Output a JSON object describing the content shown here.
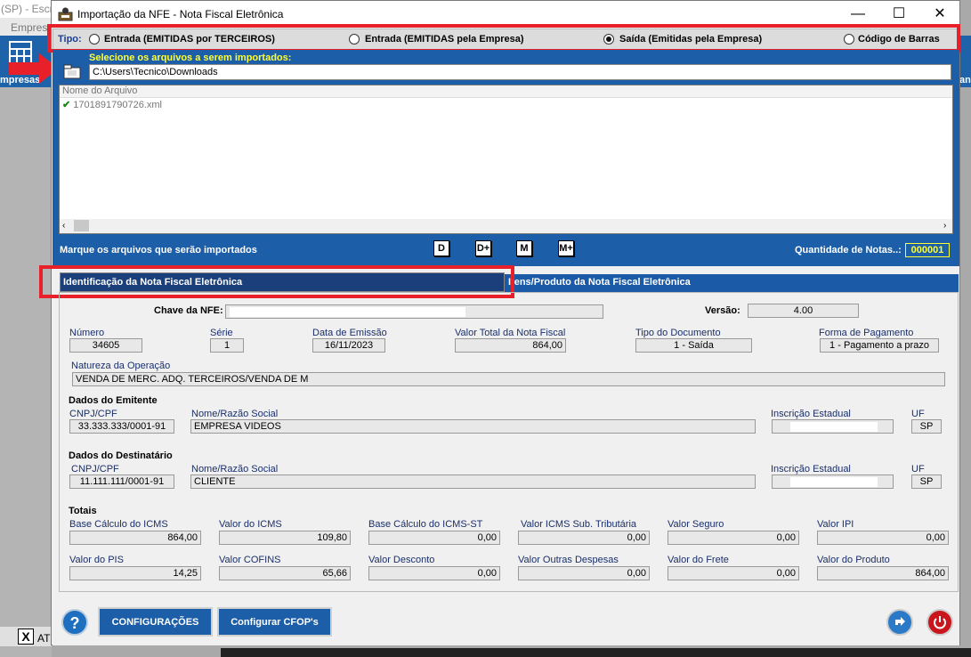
{
  "background": {
    "app_title": "(SP) - Escr",
    "menu_label": "Empres",
    "ribbon_label": "mpresas",
    "ribbon_label_right": "an",
    "close_x": "X",
    "at_label": "AT"
  },
  "window": {
    "title": "Importação da NFE - Nota Fiscal Eletrônica",
    "minimize": "—",
    "maximize": "☐",
    "close": "✕"
  },
  "tipo": {
    "label": "Tipo:",
    "options": [
      {
        "label": "Entrada (EMITIDAS por TERCEIROS)",
        "selected": false
      },
      {
        "label": "Entrada (EMITIDAS pela Empresa)",
        "selected": false
      },
      {
        "label": "Saída (Emitidas pela Empresa)",
        "selected": true
      },
      {
        "label": "Código de Barras",
        "selected": false
      }
    ]
  },
  "import": {
    "select_label": "Selecione os arquivos a serem importados:",
    "path": "C:\\Users\\Tecnico\\Downloads",
    "list_header": "Nome do Arquivo",
    "files": [
      "1701891790726.xml"
    ],
    "mark_label": "Marque os arquivos que serão importados",
    "buttons": [
      "D",
      "D+",
      "M",
      "M+"
    ],
    "qtd_label": "Quantidade de Notas..:",
    "qtd_value": "000001"
  },
  "tabs": {
    "left": "Identificação da Nota Fiscal Eletrônica",
    "right": "Itens/Produto da Nota Fiscal Eletrônica"
  },
  "nfe": {
    "chave_label": "Chave da NFE:",
    "versao_label": "Versão:",
    "versao": "4.00",
    "numero_label": "Número",
    "numero": "34605",
    "serie_label": "Série",
    "serie": "1",
    "emissao_label": "Data de Emissão",
    "emissao": "16/11/2023",
    "valor_total_label": "Valor Total da Nota Fiscal",
    "valor_total": "864,00",
    "tipo_doc_label": "Tipo do Documento",
    "tipo_doc": "1 - Saída",
    "forma_pag_label": "Forma de Pagamento",
    "forma_pag": "1 - Pagamento a prazo",
    "natureza_label": "Natureza da Operação",
    "natureza": "VENDA DE MERC. ADQ. TERCEIROS/VENDA DE M"
  },
  "emitente": {
    "section": "Dados do Emitente",
    "cnpj_label": "CNPJ/CPF",
    "cnpj": "33.333.333/0001-91",
    "nome_label": "Nome/Razão Social",
    "nome": "EMPRESA VIDEOS",
    "ie_label": "Inscrição Estadual",
    "uf_label": "UF",
    "uf": "SP"
  },
  "destinatario": {
    "section": "Dados do Destinatário",
    "cnpj_label": "CNPJ/CPF",
    "cnpj": "11.111.111/0001-91",
    "nome_label": "Nome/Razão Social",
    "nome": "CLIENTE",
    "ie_label": "Inscrição Estadual",
    "uf_label": "UF",
    "uf": "SP"
  },
  "totais": {
    "section": "Totais",
    "row1": [
      {
        "label": "Base Cálculo do ICMS",
        "value": "864,00"
      },
      {
        "label": "Valor do ICMS",
        "value": "109,80"
      },
      {
        "label": "Base Cálculo do ICMS-ST",
        "value": "0,00"
      },
      {
        "label": "Valor ICMS Sub. Tributária",
        "value": "0,00"
      },
      {
        "label": "Valor Seguro",
        "value": "0,00"
      },
      {
        "label": "Valor IPI",
        "value": "0,00"
      }
    ],
    "row2": [
      {
        "label": "Valor do PIS",
        "value": "14,25"
      },
      {
        "label": "Valor COFINS",
        "value": "65,66"
      },
      {
        "label": "Valor Desconto",
        "value": "0,00"
      },
      {
        "label": "Valor Outras Despesas",
        "value": "0,00"
      },
      {
        "label": "Valor do Frete",
        "value": "0,00"
      },
      {
        "label": "Valor do Produto",
        "value": "864,00"
      }
    ]
  },
  "footer": {
    "help": "?",
    "config": "CONFIGURAÇÕES",
    "cfop": "Configurar CFOP's"
  },
  "colors": {
    "blue_panel": "#1c5ea8",
    "highlight_red": "#e8202a",
    "yellow_label": "#ffff33"
  }
}
